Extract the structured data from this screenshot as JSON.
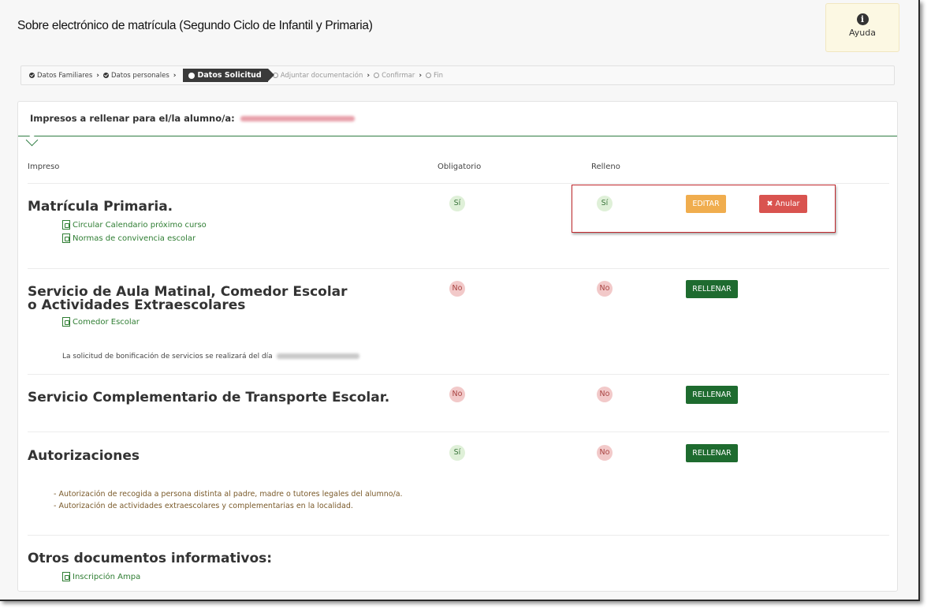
{
  "page": {
    "title": "Sobre electrónico de matrícula (Segundo Ciclo de Infantil y Primaria)"
  },
  "help": {
    "icon": "info-icon",
    "label": "Ayuda"
  },
  "breadcrumb": [
    {
      "label": "Datos Familiares",
      "state": "done"
    },
    {
      "label": "Datos personales",
      "state": "done"
    },
    {
      "label": "Datos Solicitud",
      "state": "active"
    },
    {
      "label": "Adjuntar documentación",
      "state": "todo"
    },
    {
      "label": "Confirmar",
      "state": "todo"
    },
    {
      "label": "Fin",
      "state": "todo"
    }
  ],
  "panel": {
    "heading": "Impresos a rellenar para el/la alumno/a:"
  },
  "columns": {
    "impreso": "Impreso",
    "obligatorio": "Obligatorio",
    "relleno": "Relleno"
  },
  "rows": [
    {
      "title": "Matrícula Primaria.",
      "links": [
        "Circular Calendario próximo curso",
        "Normas de convivencia escolar"
      ],
      "obligatorio": "Sí",
      "relleno": "Sí",
      "edit_label": "EDITAR",
      "cancel_label": "Anular"
    },
    {
      "title": "Servicio de Aula Matinal, Comedor Escolar o Actividades Extraescolares",
      "links": [
        "Comedor Escolar"
      ],
      "note": "La solicitud de bonificación de servicios se realizará del día",
      "obligatorio": "No",
      "relleno": "No",
      "fill_label": "RELLENAR"
    },
    {
      "title": "Servicio Complementario de Transporte Escolar.",
      "obligatorio": "No",
      "relleno": "No",
      "fill_label": "RELLENAR"
    },
    {
      "title": "Autorizaciones",
      "items": [
        "- Autorización de recogida a persona distinta al padre, madre o tutores legales del alumno/a.",
        "- Autorización de actividades extraescolares y complementarias en la localidad."
      ],
      "obligatorio": "Sí",
      "relleno": "No",
      "fill_label": "RELLENAR"
    }
  ],
  "other_docs": {
    "title": "Otros documentos informativos:",
    "links": [
      "Inscripción Ampa"
    ]
  },
  "colors": {
    "accent_green": "#1e6b2f",
    "edit_orange": "#f0ad4e",
    "cancel_red": "#d9534f",
    "highlight_red": "#c0282d"
  }
}
